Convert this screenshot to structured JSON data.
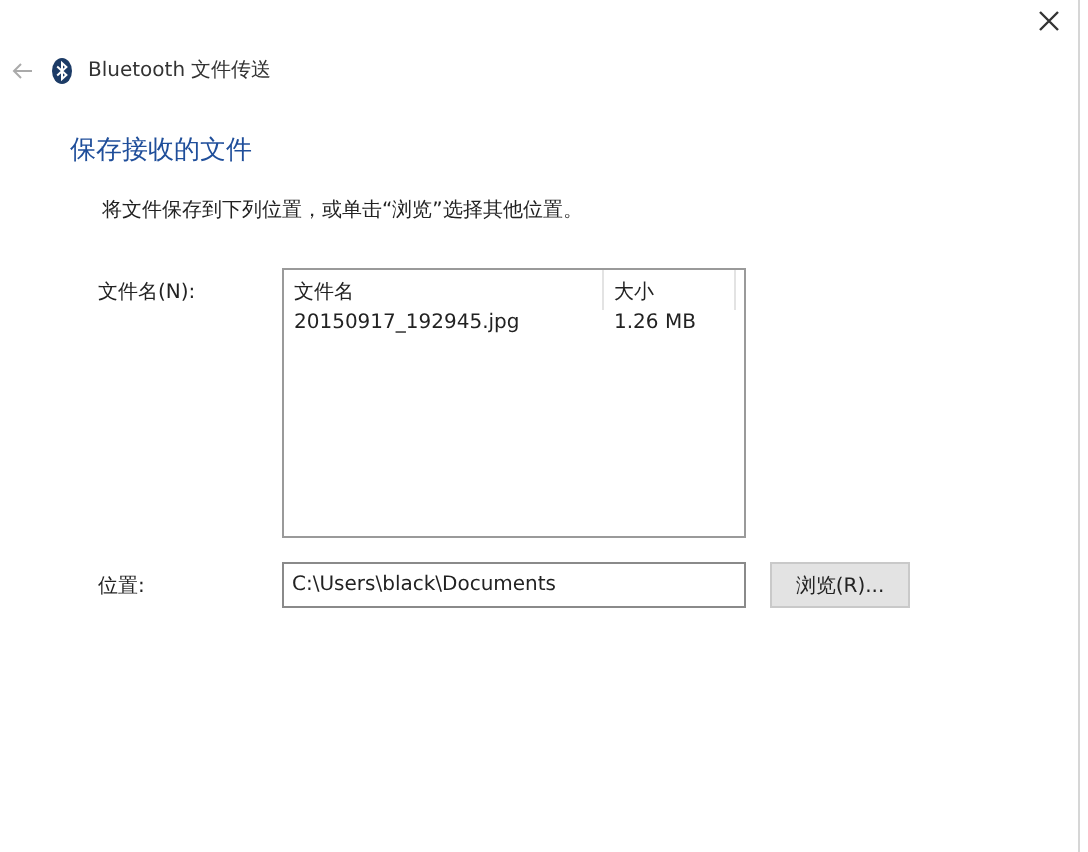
{
  "window": {
    "title": "Bluetooth 文件传送"
  },
  "heading": "保存接收的文件",
  "instruction": "将文件保存到下列位置，或单击“浏览”选择其他位置。",
  "files": {
    "label": "文件名(N):",
    "columns": [
      "文件名",
      "大小"
    ],
    "rows": [
      {
        "name": "20150917_192945.jpg",
        "size": "1.26 MB"
      }
    ]
  },
  "location": {
    "label": "位置:",
    "value": "C:\\Users\\black\\Documents",
    "browse_button": "浏览(R)..."
  }
}
